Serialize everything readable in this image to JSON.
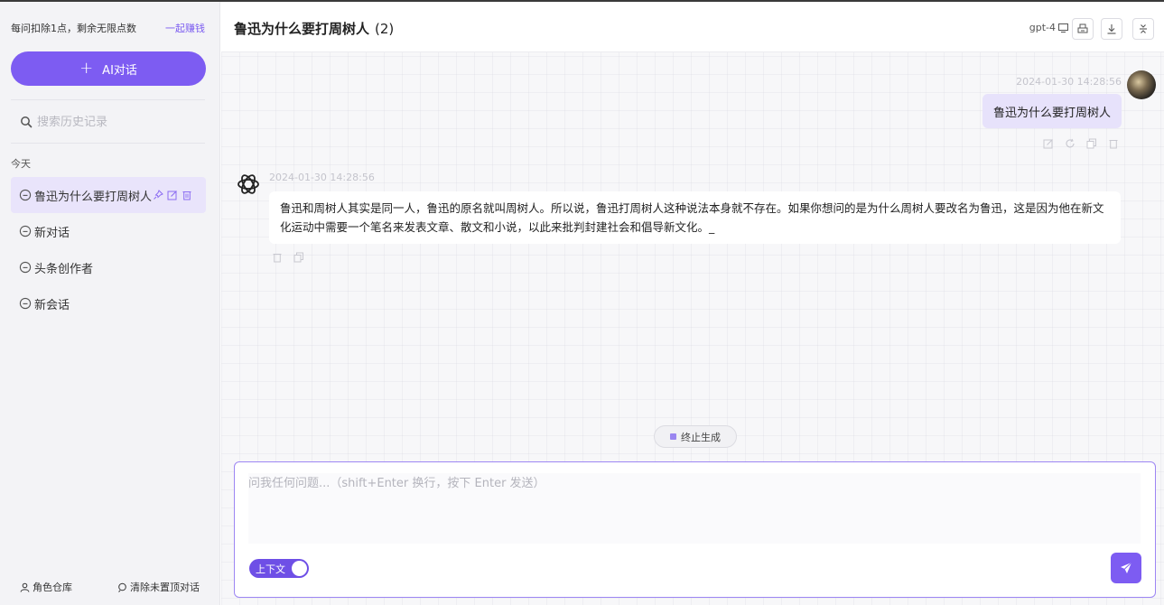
{
  "sidebar": {
    "credits_text": "每问扣除1点，剩余无限点数",
    "earn_link": "一起赚钱",
    "new_chat_label": "AI对话",
    "search_placeholder": "搜索历史记录",
    "group_today": "今天",
    "chats": [
      {
        "label": "鲁迅为什么要打周树人",
        "active": true
      },
      {
        "label": "新对话"
      },
      {
        "label": "头条创作者"
      },
      {
        "label": "新会话"
      }
    ],
    "footer": {
      "roles_label": "角色仓库",
      "clear_label": "清除未置顶对话"
    }
  },
  "header": {
    "title": "鲁迅为什么要打周树人",
    "count": "(2)",
    "model": "gpt-4"
  },
  "messages": {
    "user": {
      "timestamp": "2024-01-30 14:28:56",
      "text": "鲁迅为什么要打周树人"
    },
    "assistant": {
      "timestamp": "2024-01-30 14:28:56",
      "text": "鲁迅和周树人其实是同一人，鲁迅的原名就叫周树人。所以说，鲁迅打周树人这种说法本身就不存在。如果你想问的是为什么周树人要改名为鲁迅，这是因为他在新文化运动中需要一个笔名来发表文章、散文和小说，以此来批判封建社会和倡导新文化。_"
    }
  },
  "controls": {
    "stop_label": "终止生成",
    "input_placeholder": "问我任何问题...（shift+Enter 换行，按下 Enter 发送）",
    "context_toggle_label": "上下文",
    "context_toggle_on": true
  },
  "colors": {
    "accent": "#7d5cf2",
    "user_bubble": "#e7e2fb",
    "active_item": "#e9e4fb"
  }
}
